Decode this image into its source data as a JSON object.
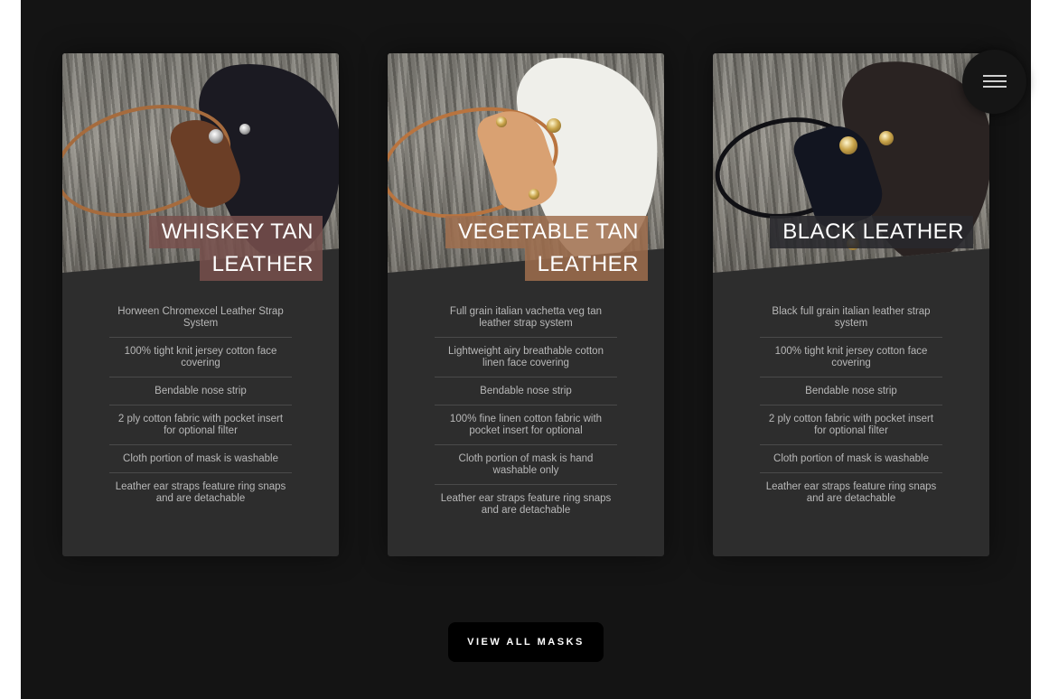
{
  "menu": {
    "icon": "hamburger-icon"
  },
  "products": [
    {
      "title_lines": [
        "WHISKEY TAN",
        "LEATHER"
      ],
      "label_color": "#7e5752",
      "features": [
        "Horween Chromexcel Leather Strap System",
        "100% tight knit jersey cotton face covering",
        "Bendable nose strip",
        "2 ply cotton fabric with pocket insert for optional filter",
        "Cloth portion of mask is washable",
        "Leather ear straps feature ring snaps and are detachable"
      ]
    },
    {
      "title_lines": [
        "VEGETABLE TAN",
        "LEATHER"
      ],
      "label_color": "#9a6b4c",
      "features": [
        "Full grain italian vachetta veg tan leather strap system",
        "Lightweight airy breathable cotton linen face covering",
        "Bendable nose strip",
        "100% fine linen cotton fabric with pocket insert for optional",
        "Cloth portion of mask is hand washable only",
        "Leather ear straps feature ring snaps and are detachable"
      ]
    },
    {
      "title_lines": [
        "BLACK LEATHER"
      ],
      "label_color": "#2b2b2f",
      "features": [
        "Black full grain italian leather strap system",
        "100% tight knit jersey cotton face covering",
        "Bendable nose strip",
        "2 ply cotton fabric with pocket insert for optional filter",
        "Cloth portion of mask is washable",
        "Leather ear straps feature ring snaps and are detachable"
      ]
    }
  ],
  "cta": {
    "label": "VIEW ALL MASKS"
  }
}
